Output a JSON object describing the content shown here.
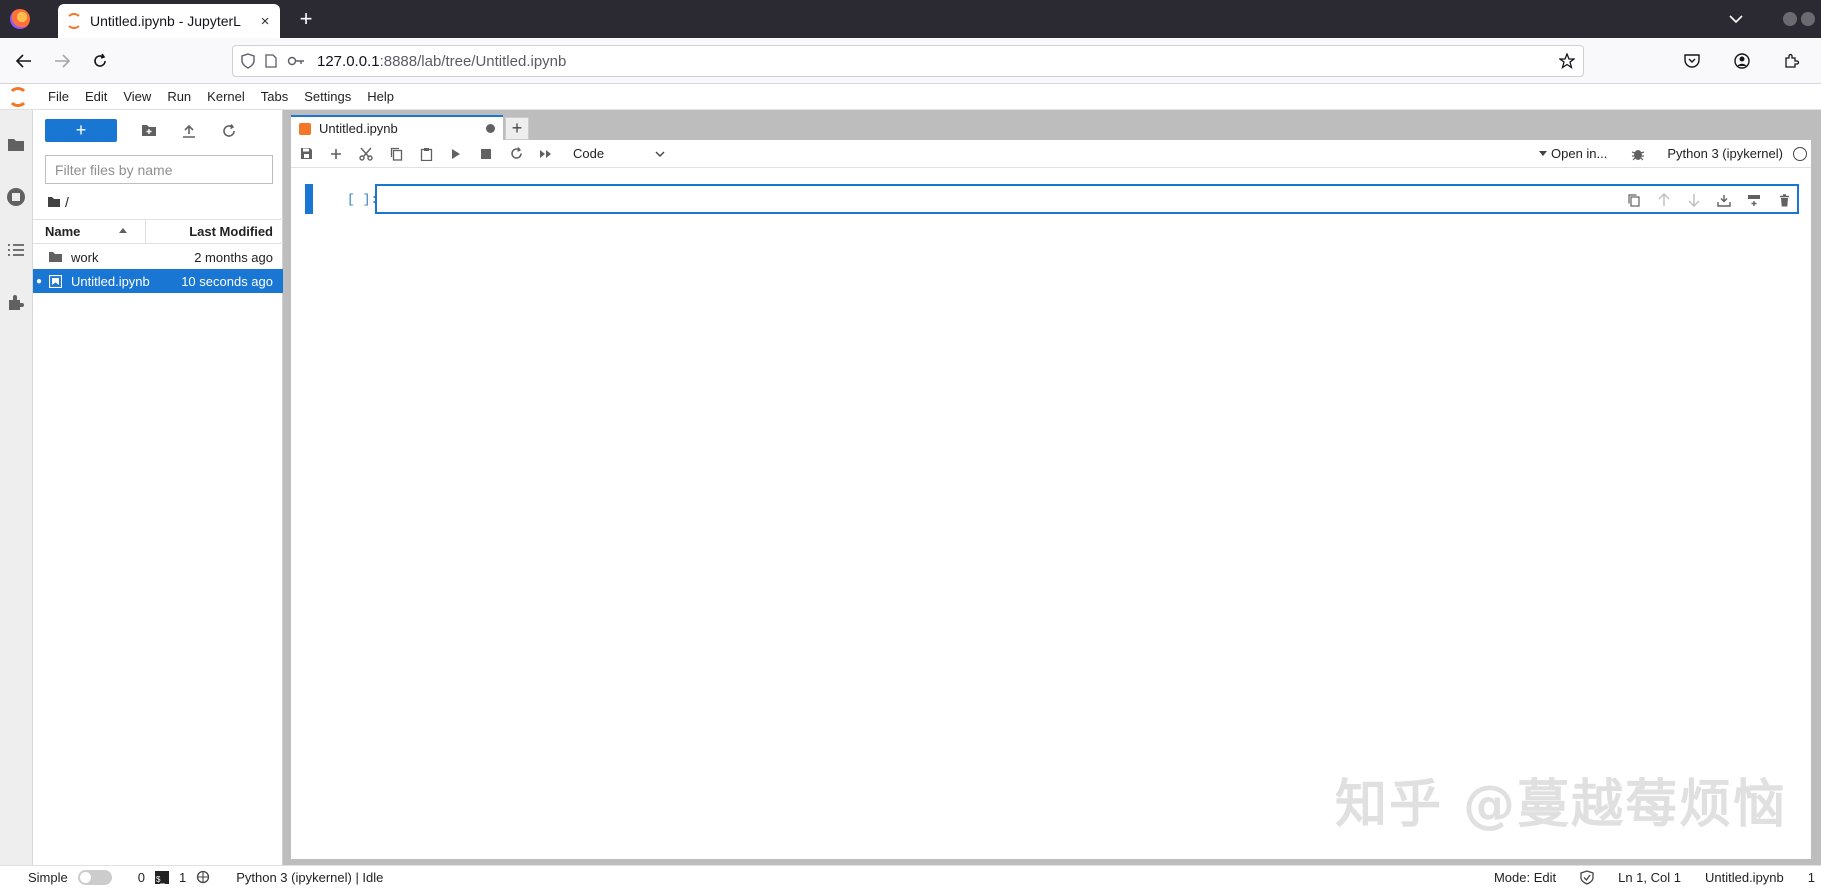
{
  "browser": {
    "tab_title": "Untitled.ipynb - JupyterL",
    "tab_close": "×",
    "new_tab": "+",
    "url_host": "127.0.0.1",
    "url_path": ":8888/lab/tree/Untitled.ipynb"
  },
  "menu": {
    "items": [
      "File",
      "Edit",
      "View",
      "Run",
      "Kernel",
      "Tabs",
      "Settings",
      "Help"
    ]
  },
  "filebrowser": {
    "new_label": "+",
    "filter_placeholder": "Filter files by name",
    "breadcrumb": "/",
    "col_name": "Name",
    "col_modified": "Last Modified",
    "files": [
      {
        "name": "work",
        "modified": "2 months ago",
        "icon": "folder-icon",
        "selected": false
      },
      {
        "name": "Untitled.ipynb",
        "modified": "10 seconds ago",
        "icon": "notebook-icon",
        "selected": true
      }
    ]
  },
  "notebook": {
    "tab_label": "Untitled.ipynb",
    "add_tab": "+",
    "cell_type": "Code",
    "open_in": "Open in...",
    "kernel_name": "Python 3 (ipykernel)",
    "cell_prompt": "[ ]:"
  },
  "watermark": "知乎 @蔓越莓烦恼",
  "status": {
    "mode_label": "Simple",
    "count_a": "0",
    "count_b": "1",
    "kernel_status": "Python 3 (ipykernel) | Idle",
    "mode": "Mode: Edit",
    "position": "Ln 1, Col 1",
    "filename": "Untitled.ipynb",
    "extra": "1"
  },
  "colors": {
    "accent": "#1976d2",
    "jupyter_orange": "#f37726"
  }
}
